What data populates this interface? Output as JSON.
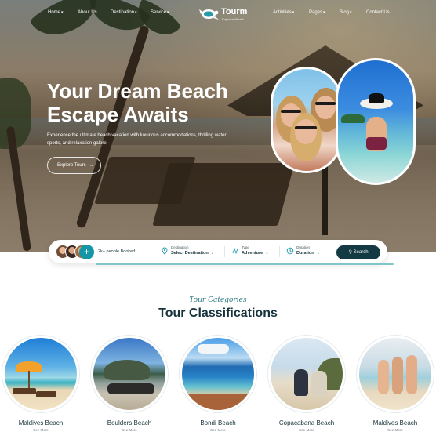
{
  "nav": {
    "left": [
      {
        "label": "Home",
        "has_dropdown": true
      },
      {
        "label": "About Us",
        "has_dropdown": false
      },
      {
        "label": "Destination",
        "has_dropdown": true
      },
      {
        "label": "Service",
        "has_dropdown": true
      }
    ],
    "right": [
      {
        "label": "Activities",
        "has_dropdown": true
      },
      {
        "label": "Pages",
        "has_dropdown": true
      },
      {
        "label": "Blog",
        "has_dropdown": true
      },
      {
        "label": "Contact Us",
        "has_dropdown": false
      }
    ],
    "logo_text": "Tourm",
    "logo_sub": "Explore World"
  },
  "hero": {
    "title_line1": "Your Dream Beach",
    "title_line2": "Escape Awaits",
    "description": "Experience the ultimate beach vacation with luxurious accommodations, thrilling water sports, and relaxation galore.",
    "cta_label": "Explore Tours",
    "cta_icon": "arrow-right-icon"
  },
  "search": {
    "plus_label": "+",
    "booked_text": "2k+ people Booked",
    "fields": [
      {
        "label": "Destination",
        "value": "Select Destination",
        "icon": "map-pin-icon"
      },
      {
        "label": "Type",
        "value": "Adventure",
        "icon": "route-icon"
      },
      {
        "label": "Duration",
        "value": "Duration",
        "icon": "clock-icon"
      }
    ],
    "button_label": "Search",
    "button_icon": "search-icon"
  },
  "categories": {
    "subtitle": "Tour Categories",
    "title": "Tour Classifications",
    "more_label": "See More",
    "items": [
      {
        "name": "Maldives Beach"
      },
      {
        "name": "Boulders Beach"
      },
      {
        "name": "Bondi Beach"
      },
      {
        "name": "Copacabana Beach"
      },
      {
        "name": "Maldives Beach"
      }
    ]
  },
  "colors": {
    "primary_dark": "#133a42",
    "accent_teal": "#1596a7",
    "text_dark": "#16323a"
  }
}
